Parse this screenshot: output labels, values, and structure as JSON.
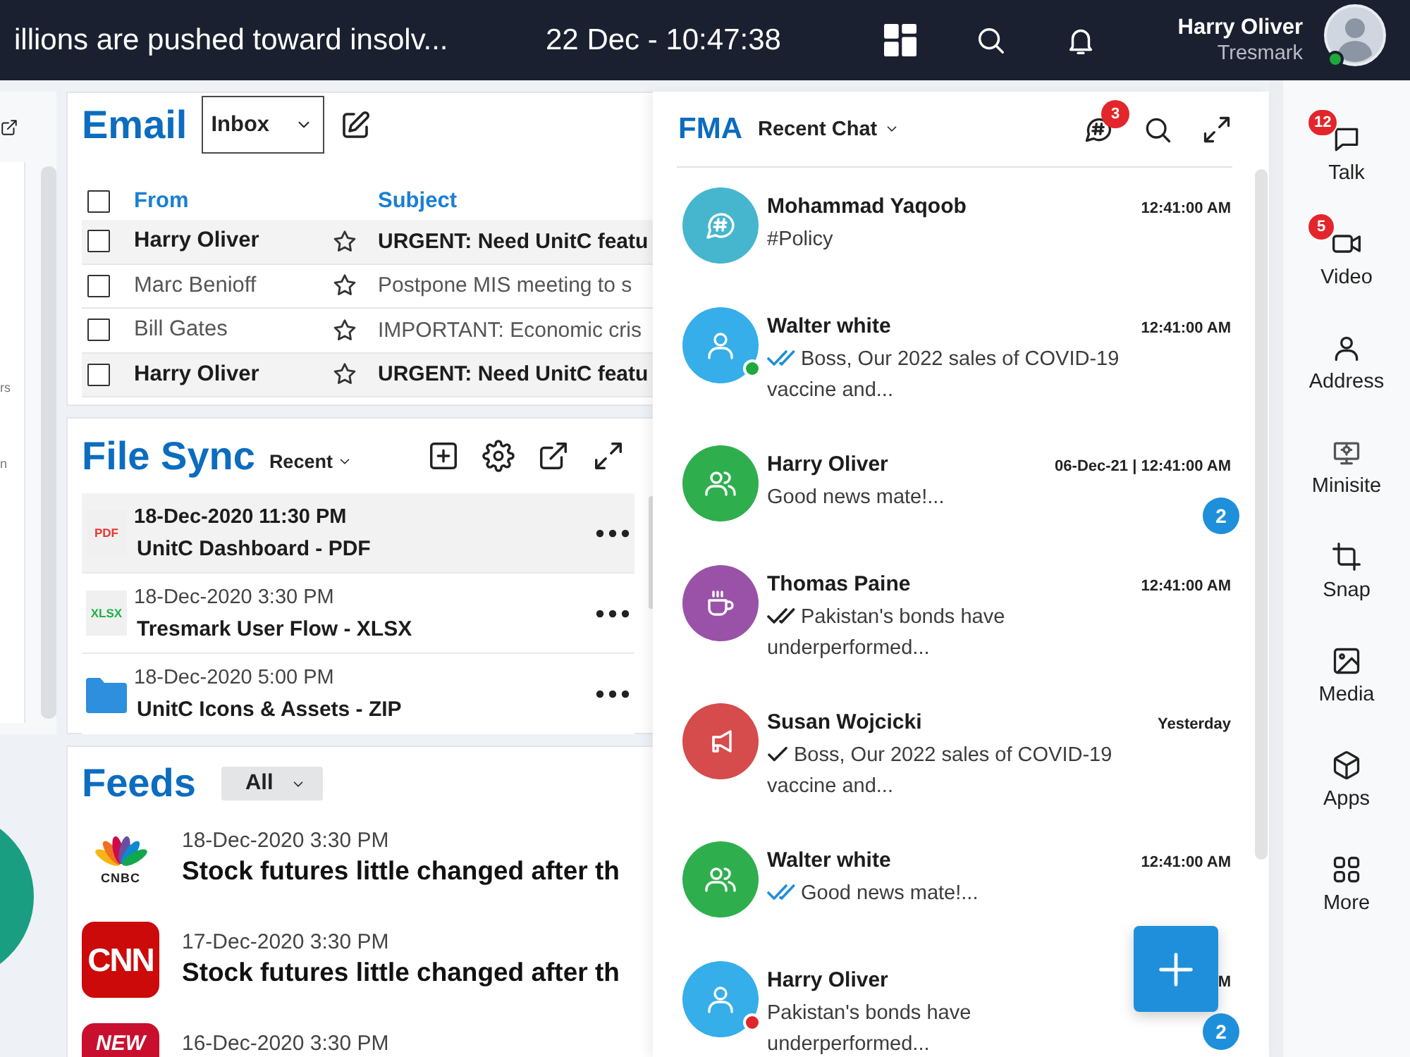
{
  "top_bar": {
    "ticker": "illions are pushed toward insolv...",
    "datetime": "22 Dec - 10:47:38",
    "user": {
      "name": "Harry Oliver",
      "company": "Tresmark",
      "status": {
        "color": "#1fa83d"
      }
    }
  },
  "left_panel": {
    "fragments": [
      "rs",
      "n"
    ]
  },
  "email": {
    "title": "Email",
    "folder": "Inbox",
    "select_all": {
      "checked": false
    },
    "columns": [
      "From",
      "Subject"
    ],
    "rows": [
      {
        "from": "Harry Oliver",
        "subject": "URGENT: Need UnitC featu",
        "unread": true,
        "checked": false,
        "starred": false
      },
      {
        "from": "Marc Benioff",
        "subject": "Postpone MIS meeting to s",
        "unread": false,
        "checked": false,
        "starred": false
      },
      {
        "from": "Bill Gates",
        "subject": "IMPORTANT: Economic cris",
        "unread": false,
        "checked": false,
        "starred": false
      },
      {
        "from": "Harry Oliver",
        "subject": "URGENT: Need UnitC featu",
        "unread": true,
        "checked": false,
        "starred": false
      }
    ]
  },
  "file_sync": {
    "title": "File Sync",
    "filter": "Recent",
    "files": [
      {
        "kind": "pdf",
        "type_label": "PDF",
        "date": "18-Dec-2020 11:30 PM",
        "name": "UnitC Dashboard - PDF",
        "selected": true
      },
      {
        "kind": "xlsx",
        "type_label": "XLSX",
        "date": "18-Dec-2020 3:30 PM",
        "name": "Tresmark User Flow - XLSX",
        "selected": false
      },
      {
        "kind": "folder",
        "date": "18-Dec-2020 5:00 PM",
        "name": "UnitC Icons & Assets - ZIP",
        "selected": false
      }
    ]
  },
  "feeds": {
    "title": "Feeds",
    "filter": "All",
    "items": [
      {
        "kind": "cnbc",
        "logo_text": "CNBC",
        "date": "18-Dec-2020 3:30 PM",
        "headline": "Stock futures little changed after th"
      },
      {
        "kind": "cnn",
        "logo_text": "CNN",
        "date": "17-Dec-2020 3:30 PM",
        "headline": "Stock futures little changed after th"
      },
      {
        "kind": "post",
        "logo_text": "NEW",
        "date": "16-Dec-2020 3:30 PM"
      }
    ]
  },
  "chat": {
    "app": "FMA",
    "view": "Recent Chat",
    "notifications": "3",
    "conversations": [
      {
        "name": "Mohammad Yaqoob",
        "kind": "channel",
        "color": "#45b6cd",
        "time": "12:41:00 AM",
        "preview": "#Policy"
      },
      {
        "name": "Walter white",
        "kind": "person",
        "color": "#35aeea",
        "time": "12:41:00 AM",
        "tick": {
          "kind": "double",
          "color": "#1e8fdb"
        },
        "preview": "Boss, Our 2022 sales of COVID-19 vaccine and...",
        "status": {
          "color": "#1fa83d"
        }
      },
      {
        "name": "Harry Oliver",
        "kind": "group",
        "color": "#2fae4e",
        "time": "06-Dec-21 | 12:41:00 AM",
        "preview": "Good news mate!...",
        "unread": "2"
      },
      {
        "name": "Thomas Paine",
        "kind": "cup",
        "color": "#9a52a8",
        "time": "12:41:00 AM",
        "tick": {
          "kind": "double",
          "color": "#222222"
        },
        "preview": "Pakistan's bonds have underperformed..."
      },
      {
        "name": "Susan Wojcicki",
        "kind": "megaphone",
        "color": "#d64b4b",
        "time": "Yesterday",
        "tick": {
          "kind": "single",
          "color": "#222222"
        },
        "preview": "Boss, Our 2022 sales of COVID-19 vaccine and..."
      },
      {
        "name": "Walter white",
        "kind": "group",
        "color": "#2fae4e",
        "time": "12:41:00 AM",
        "tick": {
          "kind": "double",
          "color": "#1e8fdb"
        },
        "preview": "Good news mate!..."
      },
      {
        "name": "Harry Oliver",
        "kind": "person",
        "color": "#35aeea",
        "time": "M",
        "preview": "Pakistan's bonds have underperformed...",
        "status": {
          "color": "#e0262b"
        },
        "unread": "2"
      }
    ]
  },
  "sidebar": {
    "items": [
      {
        "kind": "talk",
        "label": "Talk",
        "badge": "12"
      },
      {
        "kind": "video",
        "label": "Video",
        "badge": "5"
      },
      {
        "kind": "address",
        "label": "Address"
      },
      {
        "kind": "minisite",
        "label": "Minisite"
      },
      {
        "kind": "snap",
        "label": "Snap"
      },
      {
        "kind": "media",
        "label": "Media"
      },
      {
        "kind": "apps",
        "label": "Apps"
      },
      {
        "kind": "more",
        "label": "More"
      }
    ]
  }
}
